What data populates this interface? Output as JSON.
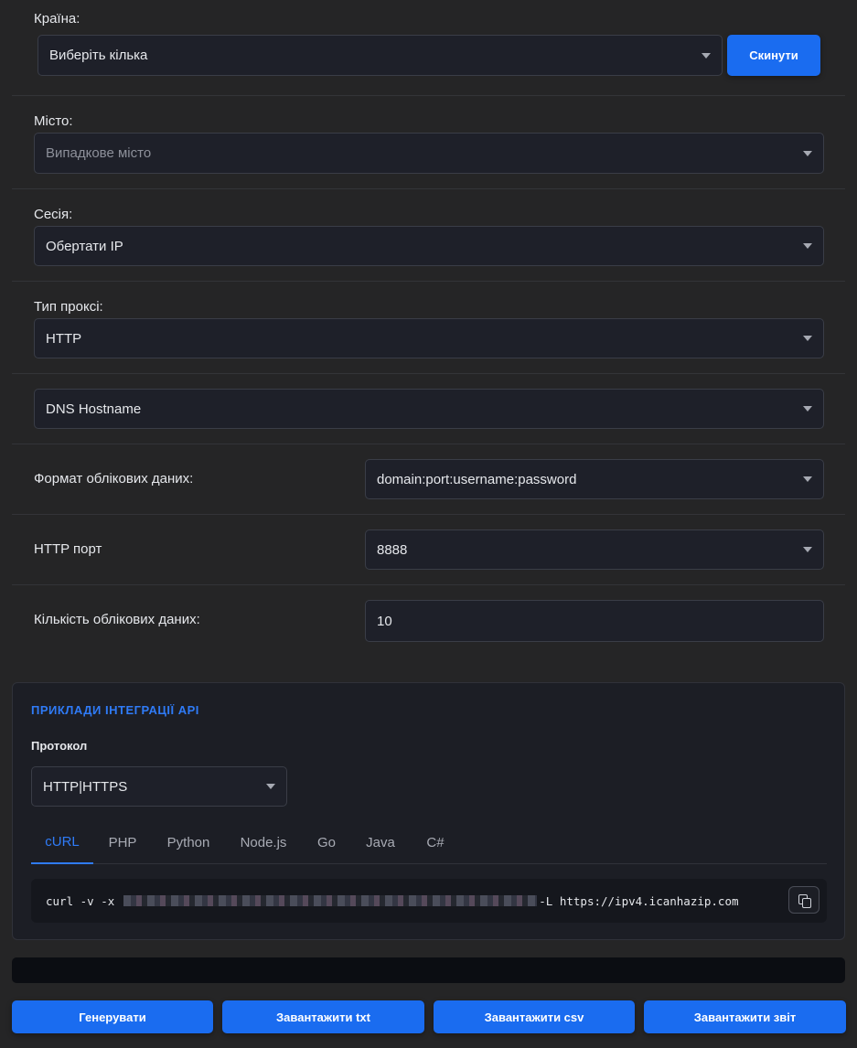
{
  "country": {
    "label": "Країна:",
    "value": "Виберіть кілька",
    "reset_label": "Скинути"
  },
  "city": {
    "label": "Місто:",
    "placeholder": "Випадкове місто"
  },
  "session": {
    "label": "Сесія:",
    "value": "Обертати IP"
  },
  "proxy_type": {
    "label": "Тип проксі:",
    "value": "HTTP"
  },
  "host": {
    "value": "DNS Hostname"
  },
  "credential_format": {
    "label": "Формат облікових даних:",
    "value": "domain:port:username:password"
  },
  "http_port": {
    "label": "HTTP порт",
    "value": "8888"
  },
  "credential_count": {
    "label": "Кількість облікових даних:",
    "value": "10"
  },
  "api": {
    "title": "ПРИКЛАДИ ІНТЕГРАЦІЇ API",
    "protocol_label": "Протокол",
    "protocol_value": "HTTP|HTTPS",
    "tabs": [
      "cURL",
      "PHP",
      "Python",
      "Node.js",
      "Go",
      "Java",
      "C#"
    ],
    "active_tab": "cURL",
    "code_prefix": "curl -v -x",
    "code_suffix": "-L https://ipv4.icanhazip.com"
  },
  "actions": {
    "generate": "Генерувати",
    "download_txt": "Завантажити txt",
    "download_csv": "Завантажити csv",
    "download_report": "Завантажити звіт"
  },
  "colors": {
    "accent": "#1a6cf0",
    "background": "#252526",
    "panel": "#1e2029"
  }
}
